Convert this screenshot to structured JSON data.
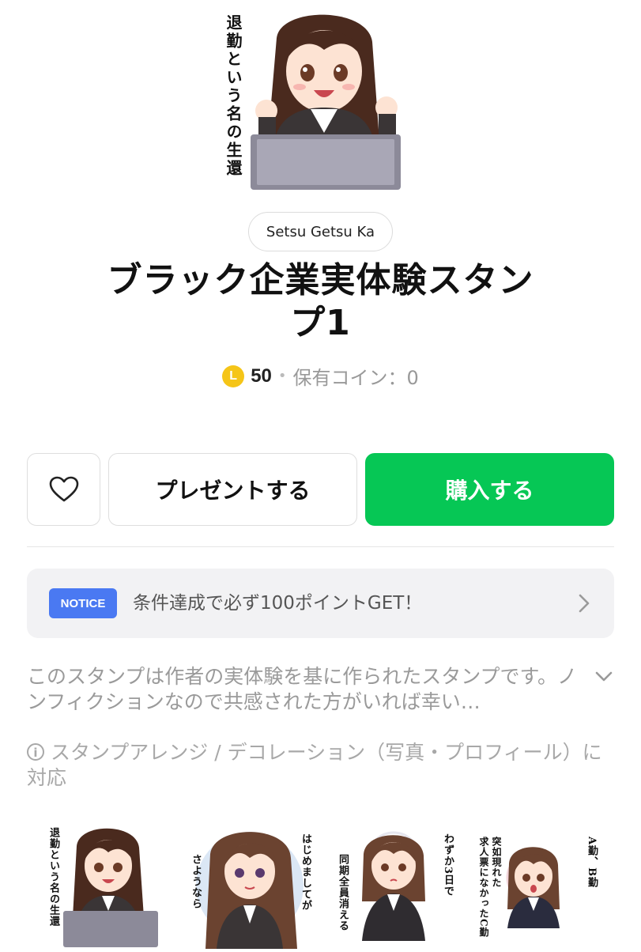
{
  "hero": {
    "caption": "退勤という名の生還"
  },
  "author": "Setsu Getsu Ka",
  "title_line1": "ブラック企業実体験スタン",
  "title_line2": "プ1",
  "price": {
    "coin_symbol": "L",
    "amount": "50",
    "separator": "•",
    "owned_label": "保有コイン：0"
  },
  "actions": {
    "gift_label": "プレゼントする",
    "buy_label": "購入する"
  },
  "notice": {
    "badge": "NOTICE",
    "text": "条件達成で必ず100ポイントGET！"
  },
  "description": "このスタンプは作者の実体験を基に作られたスタンプです。ノンフィクションなので共感された方がいれば幸い…",
  "arrange_note": "スタンプアレンジ / デコレーション（写真・プロフィール）に対応",
  "stickers": [
    {
      "lines": [
        "退勤という名の生還"
      ]
    },
    {
      "lines": [
        "はじめましてが",
        "さようなら"
      ]
    },
    {
      "lines": [
        "わずか3日で",
        "同期全員消える"
      ]
    },
    {
      "lines": [
        "A勤、B勤",
        "突如現れた",
        "求人票になかったC勤"
      ]
    }
  ],
  "colors": {
    "buy_green": "#06c755",
    "notice_blue": "#4a79f2",
    "coin_yellow": "#f5c518"
  }
}
